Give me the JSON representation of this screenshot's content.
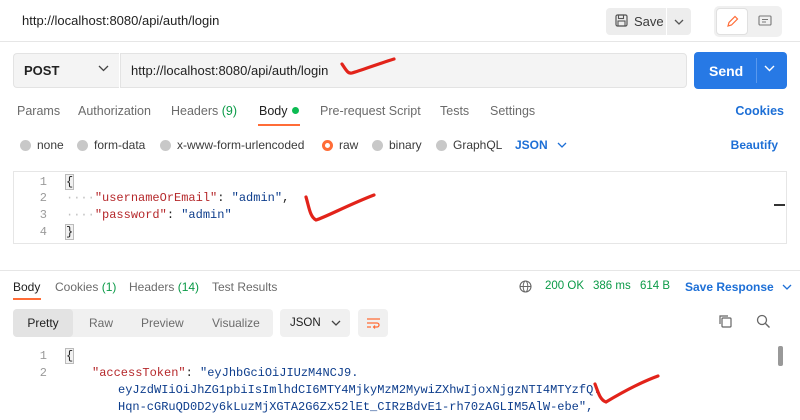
{
  "window": {
    "title": "http://localhost:8080/api/auth/login",
    "save_label": "Save"
  },
  "request": {
    "method": "POST",
    "url": "http://localhost:8080/api/auth/login",
    "send_label": "Send"
  },
  "request_tabs": {
    "params": "Params",
    "authorization": "Authorization",
    "headers": "Headers",
    "headers_count": "(9)",
    "body": "Body",
    "prerequest": "Pre-request Script",
    "tests": "Tests",
    "settings": "Settings",
    "cookies": "Cookies"
  },
  "body_types": {
    "none": "none",
    "form_data": "form-data",
    "urlencoded": "x-www-form-urlencoded",
    "raw": "raw",
    "binary": "binary",
    "graphql": "GraphQL",
    "format": "JSON",
    "beautify": "Beautify",
    "selected": "raw"
  },
  "request_body": {
    "lines": [
      {
        "n": "1",
        "open": "{"
      },
      {
        "n": "2",
        "key": "\"usernameOrEmail\"",
        "value": "\"admin\"",
        "tail": ","
      },
      {
        "n": "3",
        "key": "\"password\"",
        "value": "\"admin\"",
        "tail": ""
      },
      {
        "n": "4",
        "close": "}"
      }
    ]
  },
  "response_tabs": {
    "body": "Body",
    "cookies": "Cookies",
    "cookies_count": "(1)",
    "headers": "Headers",
    "headers_count": "(14)",
    "test_results": "Test Results"
  },
  "response_status": {
    "code": "200 OK",
    "time": "386 ms",
    "size": "614 B",
    "save_label": "Save Response"
  },
  "response_view": {
    "pretty": "Pretty",
    "raw": "Raw",
    "preview": "Preview",
    "visualize": "Visualize",
    "format": "JSON"
  },
  "response_body": {
    "line1": "1",
    "line1_text": "{",
    "line2": "2",
    "token_key": "\"accessToken\"",
    "token_part1": "\"eyJhbGciOiJIUzM4NCJ9.",
    "token_part2": "eyJzdWIiOiJhZG1pbiIsImlhdCI6MTY4MjkyMzM2MywiZXhwIjoxNjgzNTI4MTYzfQ.",
    "token_part3": "Hqn-cGRuQD0D2y6kLuzMjXGTA2G6Zx52lEt_CIRzBdvE1-rh70zAGLIM5AlW-ebe\","
  },
  "colors": {
    "accent": "#ff6c37",
    "send": "#2779e5",
    "link": "#1d6fd6",
    "success": "#0a9a47",
    "check": "#e2231a"
  }
}
